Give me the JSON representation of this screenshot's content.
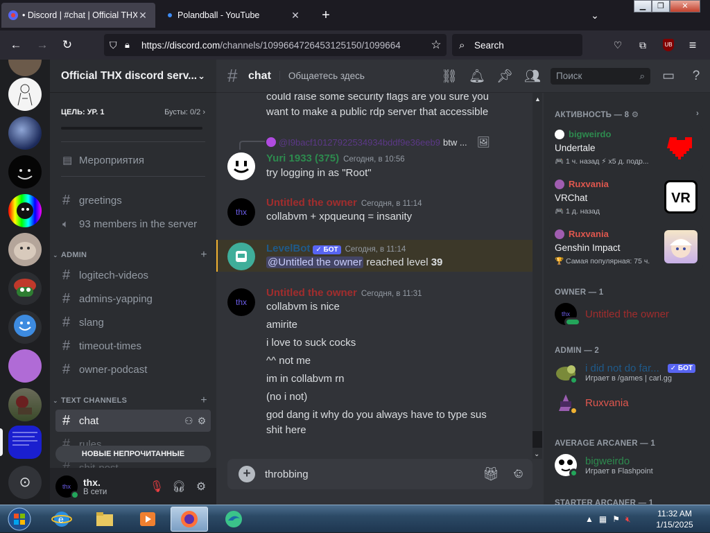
{
  "browser": {
    "tabs": [
      {
        "title": "• Discord | #chat | Official THX",
        "active": true
      },
      {
        "title": "Polandball - YouTube",
        "active": false
      }
    ],
    "url_host": "https://discord.com",
    "url_path": "/channels/1099664726453125150/1099664",
    "search_placeholder": "Search",
    "ublock_label": "UB"
  },
  "server": {
    "name": "Official THX discord serv...",
    "goal_label": "ЦЕЛЬ: УР. 1",
    "boosts_label": "Бусты: 0/2",
    "events_label": "Мероприятия",
    "channels_top": [
      {
        "name": "greetings",
        "icon": "hash"
      },
      {
        "name": "93 members in the server",
        "icon": "speaker"
      }
    ],
    "admin_category": "ADMIN",
    "admin_channels": [
      "logitech-videos",
      "admins-yapping",
      "slang",
      "timeout-times",
      "owner-podcast"
    ],
    "text_category": "TEXT CHANNELS",
    "text_channels": [
      "chat",
      "rules",
      "shit-post"
    ],
    "unread_label": "НОВЫЕ НЕПРОЧИТАННЫЕ"
  },
  "user": {
    "name": "thx.",
    "status": "В сети",
    "avatar_text": "thx"
  },
  "chat": {
    "channel": "chat",
    "topic": "Общаетесь здесь",
    "search_placeholder": "Поиск",
    "messages": [
      {
        "lines": [
          "could raise some security flags are you sure you",
          "want to make a public rdp server that accessible"
        ]
      },
      {
        "reply_to": "@I9bacf10127922534934bddf9e36eeb9",
        "reply_text": "btw ...",
        "author": "Yuri 1933 (375)",
        "author_color": "#2d8a4e",
        "time": "Сегодня, в 10:56",
        "lines": [
          "try logging in as \"Root\""
        ]
      },
      {
        "author": "Untitled the owner",
        "author_color": "#a12d2d",
        "time": "Сегодня, в 11:14",
        "lines": [
          "collabvm + xpqueunq = insanity"
        ]
      },
      {
        "author": "LevelBot",
        "author_color": "#1f5a8a",
        "bot_badge": "✓ БОТ",
        "time": "Сегодня, в 11:14",
        "mention": "@Untitled the owner",
        "text_mid": " reached level ",
        "level": "39"
      },
      {
        "author": "Untitled the owner",
        "author_color": "#a12d2d",
        "time": "Сегодня, в 11:31",
        "lines": [
          "collabvm is nice",
          "amirite",
          "i love to suck cocks",
          "^^ not me",
          "im in collabvm rn",
          "(no i not)",
          "god dang it why do you always have to type sus",
          "shit here"
        ]
      }
    ],
    "input_value": "throbbing"
  },
  "members": {
    "activity_header": "АКТИВНОСТЬ — 8",
    "activities": [
      {
        "user": "bigweirdo",
        "user_color": "#2d8a4e",
        "game": "Undertale",
        "detail": "🎮 1 ч. назад   ⚡ x5 д. подр..."
      },
      {
        "user": "Ruxvania",
        "user_color": "#e0574e",
        "game": "VRChat",
        "detail": "🎮 1 д. назад"
      },
      {
        "user": "Ruxvania",
        "user_color": "#e0574e",
        "game": "Genshin Impact",
        "detail": "🏆 Самая популярная: 75 ч."
      }
    ],
    "owner_header": "OWNER — 1",
    "owner": {
      "name": "Untitled the owner",
      "color": "#a12d2d"
    },
    "admin_header": "ADMIN — 2",
    "admins": [
      {
        "name": "i did not do far...",
        "color": "#1f5a8a",
        "bot_badge": "✓ БОТ",
        "sub": "Играет в /games | carl.gg"
      },
      {
        "name": "Ruxvania",
        "color": "#e0574e"
      }
    ],
    "avg_header": "AVERAGE ARCANER — 1",
    "avg_member": {
      "name": "bigweirdo",
      "color": "#2d8a4e",
      "sub": "Играет в Flashpoint"
    },
    "starter_header": "STARTER ARCANER — 1"
  },
  "taskbar": {
    "time": "11:32 AM",
    "date": "1/15/2025"
  },
  "colors": {
    "blurple": "#5865f2",
    "online": "#23a55a",
    "idle": "#f0b232"
  }
}
